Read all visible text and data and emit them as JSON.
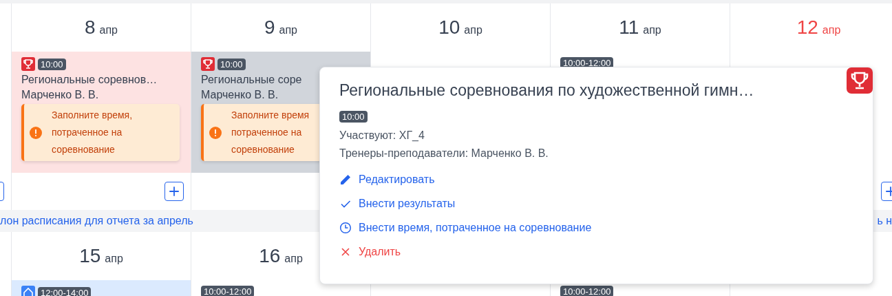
{
  "week1": [
    {
      "add_button": true
    },
    {
      "day": "8",
      "month": "апр",
      "weekend": false,
      "add_button": true,
      "events": [
        {
          "kind": "competition",
          "color": "#fde2e2",
          "time": "10:00",
          "title": "Региональные соревнов…",
          "trainer": "Марченко В. В.",
          "warning": [
            "Заполните время,",
            "потраченное на",
            "соревнование"
          ]
        }
      ]
    },
    {
      "day": "9",
      "month": "апр",
      "weekend": false,
      "events": [
        {
          "kind": "competition",
          "color": "#d1d5db",
          "time": "10:00",
          "title": "Региональные соре",
          "trainer": "Марченко В. В.",
          "warning": [
            "Заполните время",
            "потраченное на",
            "соревнование"
          ]
        }
      ]
    },
    {
      "day": "10",
      "month": "апр",
      "weekend": false
    },
    {
      "day": "11",
      "month": "апр",
      "weekend": false,
      "events": [
        {
          "kind": "plain",
          "time": "10:00-12:00"
        }
      ]
    },
    {
      "day": "12",
      "month": "апр",
      "weekend": true,
      "add_button": true
    }
  ],
  "banner": {
    "left": "лон расписания для отчета за апрель",
    "right": "ь н"
  },
  "week2": [
    {
      "day": "15",
      "month": "апр",
      "weekend": false,
      "events": [
        {
          "kind": "home",
          "color": "#dbeafe",
          "time": "12:00-14:00"
        }
      ]
    },
    {
      "day": "16",
      "month": "апр",
      "weekend": false,
      "events": [
        {
          "kind": "plain",
          "time": "10:00-12:00"
        }
      ]
    },
    {
      "events": [
        {
          "kind": "plain",
          "time": "10:00-12:00"
        }
      ]
    }
  ],
  "popover": {
    "title": "Региональные соревнования по художественной гимн…",
    "time": "10:00",
    "details": [
      "Участвуют: ХГ_4",
      "Тренеры-преподаватели: Марченко В. В."
    ],
    "actions": [
      {
        "kind": "edit",
        "label": "Редактировать"
      },
      {
        "kind": "check",
        "label": "Внести результаты"
      },
      {
        "kind": "clock",
        "label": "Внести время, потраченное на соревнование"
      },
      {
        "kind": "delete",
        "label": "Удалить"
      }
    ]
  }
}
